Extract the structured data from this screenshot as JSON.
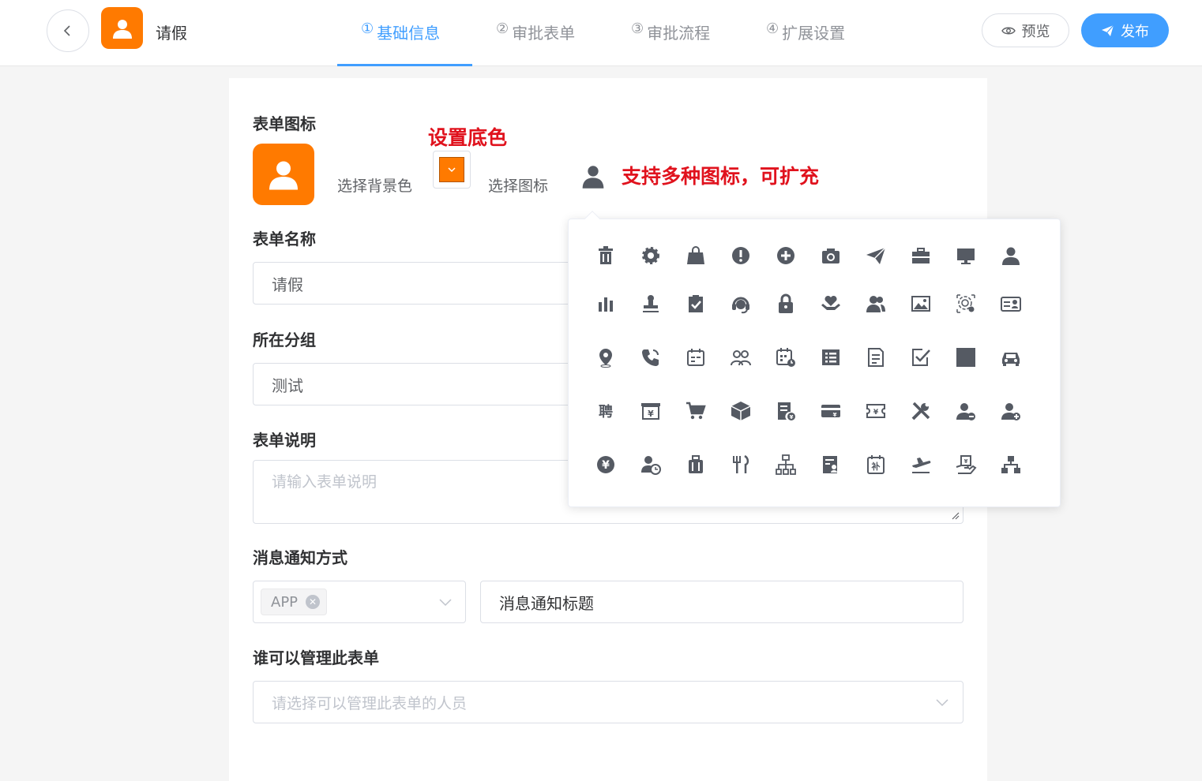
{
  "header": {
    "title": "请假",
    "steps": [
      {
        "num": "①",
        "label": "基础信息"
      },
      {
        "num": "②",
        "label": "审批表单"
      },
      {
        "num": "③",
        "label": "审批流程"
      },
      {
        "num": "④",
        "label": "扩展设置"
      }
    ],
    "preview_label": "预览",
    "publish_label": "发布"
  },
  "form": {
    "icon_label": "表单图标",
    "bg_color_label": "选择背景色",
    "icon_select_label": "选择图标",
    "bg_color": "#ff7a00",
    "annotation_bg": "设置底色",
    "annotation_icons": "支持多种图标，可扩充",
    "name_label": "表单名称",
    "name_value": "请假",
    "group_label": "所在分组",
    "group_value": "测试",
    "desc_label": "表单说明",
    "desc_placeholder": "请输入表单说明",
    "notify_label": "消息通知方式",
    "notify_tag": "APP",
    "notify_title_value": "消息通知标题",
    "manager_label": "谁可以管理此表单",
    "manager_placeholder": "请选择可以管理此表单的人员"
  },
  "icon_picker": {
    "icons": [
      "trash-icon",
      "gear-icon",
      "shopping-bag-icon",
      "alert-icon",
      "add-circle-icon",
      "camera-icon",
      "send-icon",
      "briefcase-icon",
      "monitor-icon",
      "user-icon",
      "bar-chart-icon",
      "stamp-icon",
      "clipboard-check-icon",
      "headset-icon",
      "lock-icon",
      "heart-hand-icon",
      "users-icon",
      "image-icon",
      "fingerprint-icon",
      "id-card-icon",
      "location-icon",
      "phone-icon",
      "calendar-icon",
      "group-icon",
      "calendar-clock-icon",
      "list-icon",
      "document-icon",
      "checkbox-icon",
      "square-icon",
      "car-icon",
      "recruit-icon",
      "cashier-icon",
      "cart-icon",
      "box-icon",
      "invoice-icon",
      "card-yuan-icon",
      "ticket-icon",
      "tools-icon",
      "user-remove-icon",
      "user-add-icon",
      "yuan-icon",
      "user-clock-icon",
      "luggage-icon",
      "dining-icon",
      "org-chart-icon",
      "report-icon",
      "calendar-supplement-icon",
      "flight-icon",
      "payment-hand-icon",
      "hierarchy-icon"
    ],
    "recruit_char": "聘",
    "supplement_char": "补",
    "icon_color": "#555a63"
  }
}
